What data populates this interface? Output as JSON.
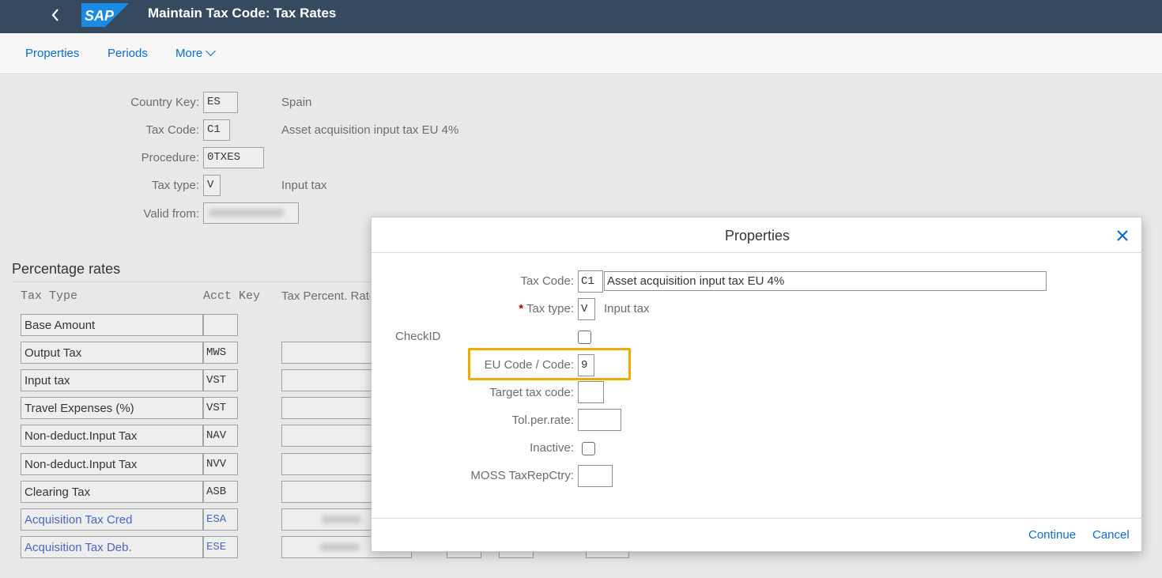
{
  "shell": {
    "title": "Maintain Tax Code: Tax Rates",
    "logo_text": "SAP"
  },
  "toolbar": {
    "properties": "Properties",
    "periods": "Periods",
    "more": "More"
  },
  "header": {
    "country_key_label": "Country Key:",
    "country_key": "ES",
    "country_name": "Spain",
    "tax_code_label": "Tax Code:",
    "tax_code": "C1",
    "tax_code_desc": "Asset acquisition input tax EU 4%",
    "procedure_label": "Procedure:",
    "procedure": "0TXES",
    "tax_type_label": "Tax type:",
    "tax_type": "V",
    "tax_type_desc": "Input tax",
    "valid_from_label": "Valid from:"
  },
  "rates": {
    "title": "Percentage rates",
    "col_tax_type": "Tax Type",
    "col_acct_key": "Acct Key",
    "col_percent": "Tax Percent. Rate",
    "rows": [
      {
        "name": "Base Amount",
        "key": ""
      },
      {
        "name": "Output Tax",
        "key": "MWS"
      },
      {
        "name": "Input tax",
        "key": "VST"
      },
      {
        "name": "Travel Expenses (%)",
        "key": "VST"
      },
      {
        "name": "Non-deduct.Input Tax",
        "key": "NAV"
      },
      {
        "name": "Non-deduct.Input Tax",
        "key": "NVV"
      },
      {
        "name": "Clearing Tax",
        "key": "ASB"
      },
      {
        "name": "Acquisition Tax Cred",
        "key": "ESA"
      },
      {
        "name": "Acquisition Tax Deb.",
        "key": "ESE"
      }
    ]
  },
  "dialog": {
    "title": "Properties",
    "tax_code_label": "Tax Code:",
    "tax_code": "C1",
    "tax_code_desc": "Asset acquisition input tax EU 4%",
    "required_mark": "*",
    "tax_type_label": "Tax type:",
    "tax_type": "V",
    "tax_type_desc": "Input tax",
    "checkid_label": "CheckID",
    "eu_code_label": "EU Code / Code:",
    "eu_code": "9",
    "target_tax_code_label": "Target tax code:",
    "target_tax_code": "",
    "tol_rate_label": "Tol.per.rate:",
    "tol_rate": "",
    "inactive_label": "Inactive:",
    "moss_label": "MOSS TaxRepCtry:",
    "moss": "",
    "continue": "Continue",
    "cancel": "Cancel"
  },
  "colors": {
    "shell_bg": "#354a5f",
    "accent": "#0a6ed1",
    "highlight": "#f0ab00",
    "required": "#bb0000"
  }
}
